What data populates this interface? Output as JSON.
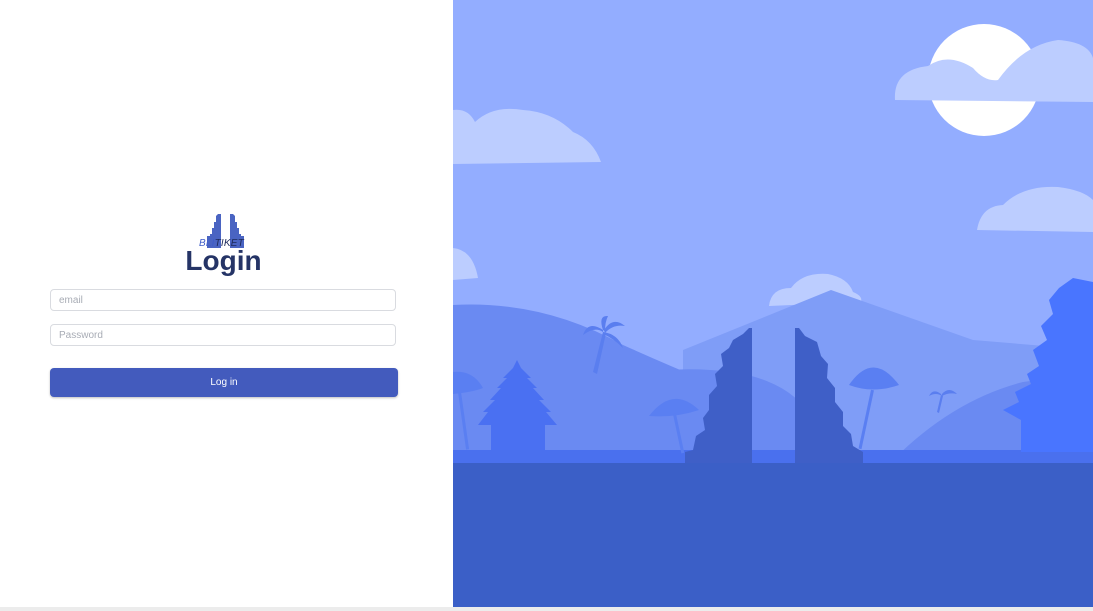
{
  "brand": {
    "part1": "BLI",
    "part2": "TIKET"
  },
  "login": {
    "title": "Login",
    "email_placeholder": "email",
    "password_placeholder": "Password",
    "submit_label": "Log in"
  },
  "colors": {
    "accent": "#435bbd",
    "title": "#253466",
    "sky": "#93adff",
    "water": "#3b5fc7"
  },
  "illustration": {
    "subject": "temple-gate-landscape"
  }
}
